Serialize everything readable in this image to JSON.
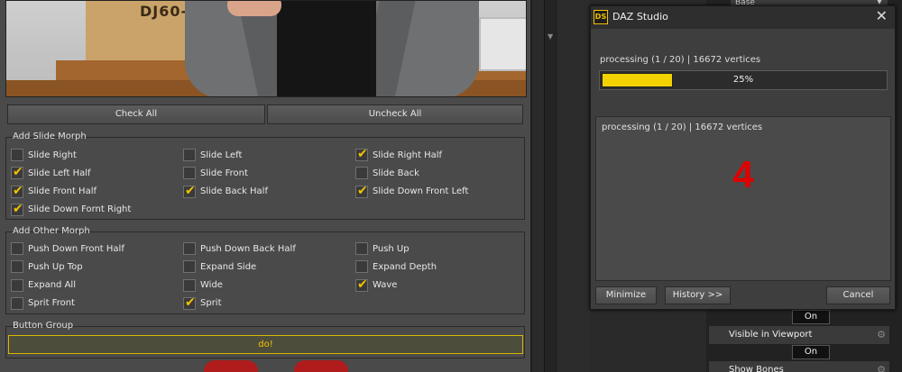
{
  "left_panel": {
    "photo": {
      "box_text": "DJ60-2"
    },
    "check_all_label": "Check All",
    "uncheck_all_label": "Uncheck All",
    "slide_group": {
      "title": "Add Slide Morph",
      "items": [
        {
          "label": "Slide Right",
          "checked": false
        },
        {
          "label": "Slide Left",
          "checked": false
        },
        {
          "label": "Slide Right Half",
          "checked": true
        },
        {
          "label": "Slide Left Half",
          "checked": true
        },
        {
          "label": "Slide Front",
          "checked": false
        },
        {
          "label": "Slide Back",
          "checked": false
        },
        {
          "label": "Slide Front Half",
          "checked": true
        },
        {
          "label": "Slide Back Half",
          "checked": true
        },
        {
          "label": "Slide Down Front Left",
          "checked": true
        },
        {
          "label": "Slide Down Fornt Right",
          "checked": true
        }
      ]
    },
    "other_group": {
      "title": "Add Other Morph",
      "items": [
        {
          "label": "Push Down Front Half",
          "checked": false
        },
        {
          "label": "Push Down Back Half",
          "checked": false
        },
        {
          "label": "Push Up",
          "checked": false
        },
        {
          "label": "Push Up Top",
          "checked": false
        },
        {
          "label": "Expand Side",
          "checked": false
        },
        {
          "label": "Expand Depth",
          "checked": false
        },
        {
          "label": "Expand All",
          "checked": false
        },
        {
          "label": "Wide",
          "checked": false
        },
        {
          "label": "Wave",
          "checked": true
        },
        {
          "label": "Sprit Front",
          "checked": false
        },
        {
          "label": "Sprit",
          "checked": true
        }
      ]
    },
    "button_group": {
      "title": "Button Group",
      "do_label": "do!"
    }
  },
  "right_panel": {
    "base_dropdown": "Base",
    "on_label_1": "On",
    "visible_in_viewport": "Visible in Viewport",
    "on_label_2": "On",
    "show_bones": "Show Bones"
  },
  "dialog": {
    "title": "DAZ Studio",
    "icon_text": "DS",
    "status": "processing (1 / 20) | 16672 vertices",
    "progress_percent": 25,
    "progress_label": "25%",
    "log_text": "processing (1 / 20) | 16672 vertices",
    "step_number": "4",
    "minimize_label": "Minimize",
    "history_label": "History >>",
    "cancel_label": "Cancel"
  },
  "colors": {
    "accent_yellow": "#f2c200",
    "step_red": "#e00000",
    "panel_bg": "#4a4a4a"
  }
}
